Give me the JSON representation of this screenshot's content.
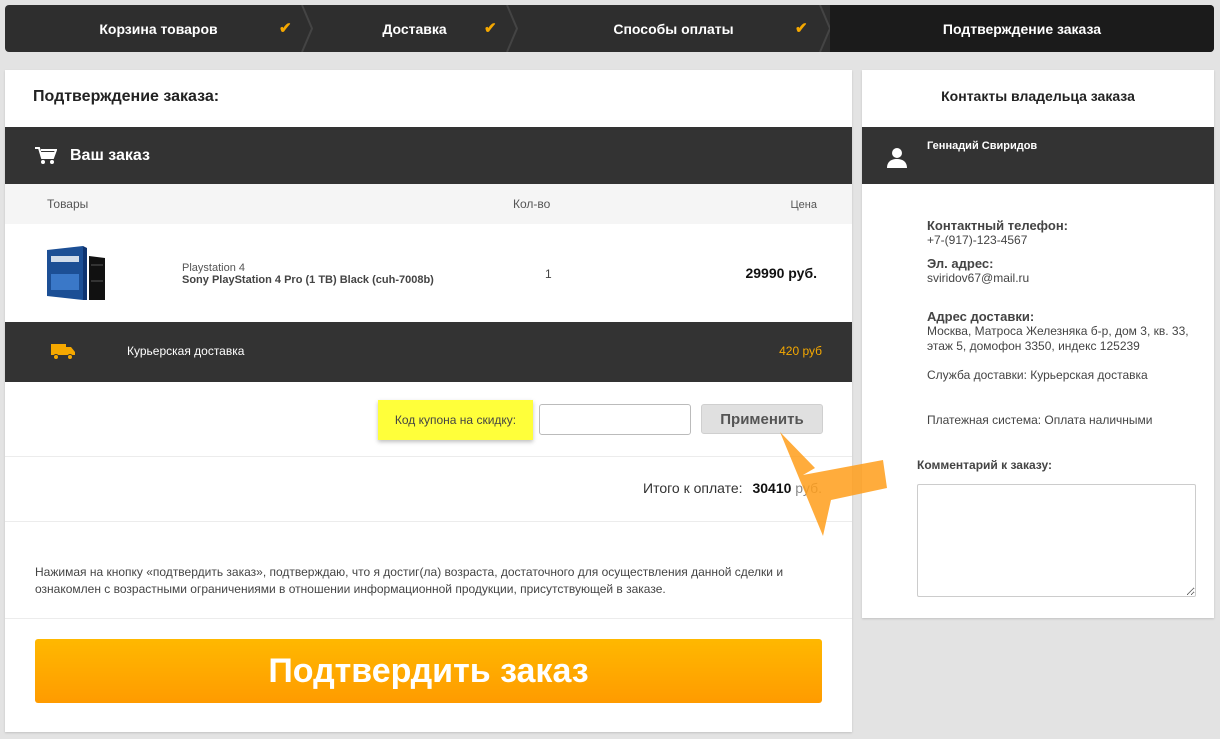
{
  "steps": [
    {
      "label": "Корзина товаров",
      "done": true
    },
    {
      "label": "Доставка",
      "done": true
    },
    {
      "label": "Способы оплаты",
      "done": true
    },
    {
      "label": "Подтверждение заказа",
      "done": false
    }
  ],
  "colors": {
    "accent": "#f5a800",
    "dark": "#333333",
    "coupon_bg": "#ffff3a",
    "confirm": "#ffa800"
  },
  "order": {
    "page_title": "Подтверждение заказа:",
    "section_title": "Ваш заказ",
    "columns": {
      "goods": "Товары",
      "qty": "Кол-во",
      "price": "Цена"
    },
    "items": [
      {
        "category": "Playstation 4",
        "name": "Sony PlayStation 4 Pro (1 TB) Black (cuh-7008b)",
        "qty": "1",
        "price": "29990 руб."
      }
    ],
    "delivery": {
      "name": "Курьерская доставка",
      "price": "420 руб"
    },
    "coupon": {
      "label": "Код купона на скидку:",
      "value": "",
      "placeholder": "",
      "apply": "Применить"
    },
    "total": {
      "label": "Итого к оплате:",
      "amount": "30410",
      "currency": "руб."
    },
    "notice": "Нажимая на кнопку «подтвердить заказ», подтверждаю, что я достиг(ла) возраста, достаточного для осуществления данной сделки и ознакомлен с возрастными ограничениями в отношении информационной продукции, присутствующей в заказе.",
    "confirm_label": "Подтвердить заказ"
  },
  "contacts": {
    "title": "Контакты владельца заказа",
    "owner": "Геннадий Свиридов",
    "phone_label": "Контактный телефон:",
    "phone": "+7-(917)-123-4567",
    "email_label": "Эл. адрес:",
    "email": "sviridov67@mail.ru",
    "address_label": "Адрес доставки:",
    "address": "Москва, Матроса Железняка б-р, дом 3, кв. 33, этаж 5, домофон 3350, индекс 125239",
    "delivery_service": "Служба доставки: Курьерская доставка",
    "payment_system": "Платежная система: Оплата наличными",
    "comment_label": "Комментарий к заказу:",
    "comment_value": ""
  },
  "icons": {
    "check": "check-icon",
    "cart": "cart-icon",
    "truck": "truck-icon",
    "user": "user-icon",
    "arrow": "pointer-arrow"
  }
}
